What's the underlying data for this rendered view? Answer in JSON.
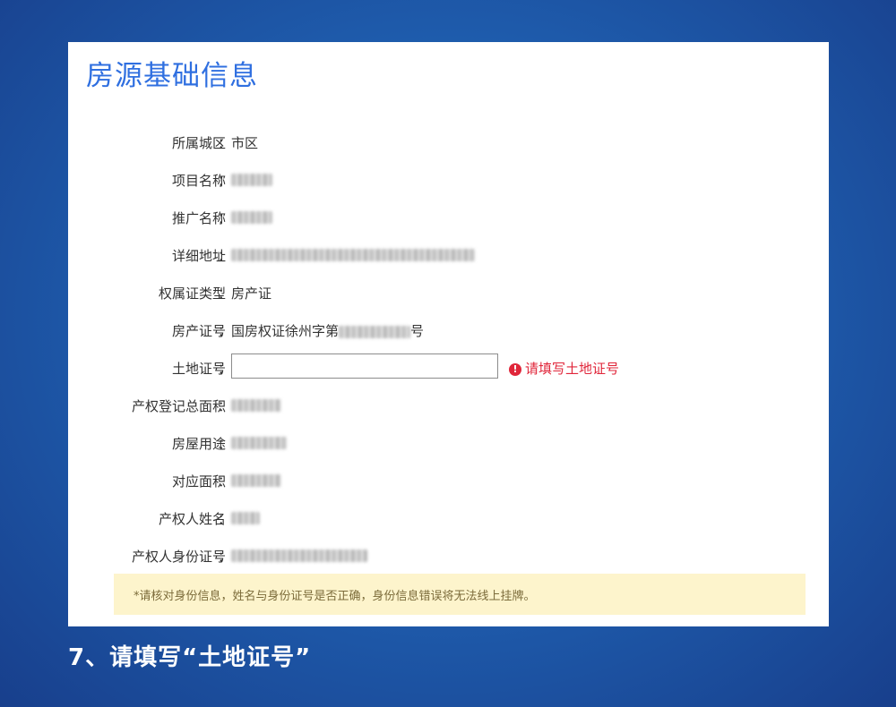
{
  "panel": {
    "title": "房源基础信息"
  },
  "colon": "：",
  "fields": {
    "district": {
      "label": "所属城区",
      "value": "市区"
    },
    "project_name": {
      "label": "项目名称",
      "value": ""
    },
    "promo_name": {
      "label": "推广名称",
      "value": ""
    },
    "address": {
      "label": "详细地址",
      "value": ""
    },
    "cert_type": {
      "label": "权属证类型",
      "value": "房产证"
    },
    "house_cert_no": {
      "label": "房产证号",
      "prefix": "国房权证徐州字第",
      "suffix": "号"
    },
    "land_cert_no": {
      "label": "土地证号",
      "input_value": "",
      "error": "请填写土地证号"
    },
    "registered_area": {
      "label": "产权登记总面积",
      "value": ""
    },
    "usage": {
      "label": "房屋用途",
      "value": ""
    },
    "area": {
      "label": "对应面积",
      "value": ""
    },
    "owner_name": {
      "label": "产权人姓名",
      "value": ""
    },
    "owner_id": {
      "label": "产权人身份证号",
      "value": ""
    }
  },
  "icons": {
    "error": "exclamation-circle-icon",
    "error_glyph": "!"
  },
  "colors": {
    "title_blue": "#2f6fe0",
    "error_red": "#e0263a",
    "notice_bg": "#fdf4cc"
  },
  "notice": "*请核对身份信息，姓名与身份证号是否正确，身份信息错误将无法线上挂牌。",
  "caption": "7、请填写“土地证号”"
}
